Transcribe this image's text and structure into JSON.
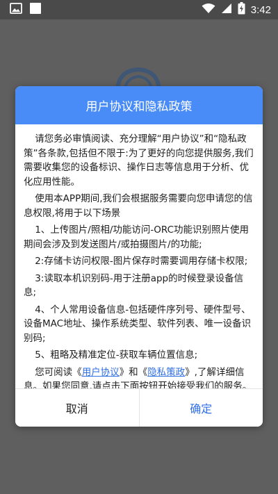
{
  "status_bar": {
    "time": "3:42",
    "icons": [
      "image-notification-icon",
      "app-notification-icon",
      "wifi-icon",
      "signal-icon",
      "battery-charging-icon"
    ]
  },
  "dialog": {
    "title": "用户协议和隐私政策",
    "paragraphs": {
      "p1": "请您务必审慎阅读、充分理解“用户协议”和“隐私政策”各条款,包括但不限于:为了更好的向您提供服务,我们需要收集您的设备标识、操作日志等信息用于分析、优化应用性能。",
      "p2": "使用本APP期间,我们会根据服务需要向您申请您的信息权限,将用于以下场景",
      "p3": "1、上传图片/照相/功能访问-ORC功能识别照片使用期间会涉及到发送图片/或拍摄图片/的功能;",
      "p4": "2:存储卡访问权限-图片保存时需要调用存储卡权限;",
      "p5": "3:读取本机识别码-用于注册app的时候登录设备信息;",
      "p6": "4、个人常用设备信息-包括硬件序列号、硬件型号、设备MAC地址、操作系统类型、软件列表、唯一设备识别码;",
      "p7": "5、粗略及精准定位-获取车辆位置信息;"
    },
    "last_paragraph": {
      "prefix": "您可阅读《",
      "user_agreement_link": "用户协议",
      "middle": "》和《",
      "privacy_policy_link": "隐私策政",
      "suffix": "》,了解详细信息。如果您同意,请点击下面按钮开始接受我们的服务。"
    },
    "cancel_label": "取消",
    "confirm_label": "确定"
  },
  "colors": {
    "accent": "#4a8cf7",
    "link": "#2f6fe4",
    "overlay": "#5f5f5f"
  }
}
